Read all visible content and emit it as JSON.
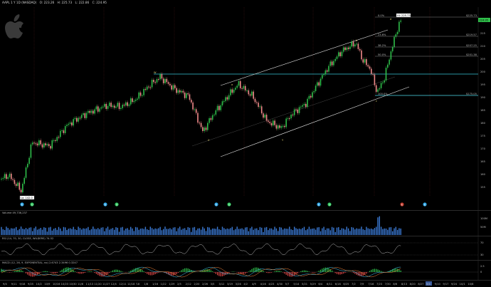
{
  "header": {
    "symbol": "AAPL 1 Y 1D (NASDAQ)",
    "open": "O: 223.26",
    "high": "H: 225.73",
    "low": "L: 222.86",
    "close": "C: 224.95"
  },
  "price_axis": {
    "labels": [
      "220",
      "215",
      "210",
      "205",
      "200",
      "195",
      "190",
      "185",
      "180",
      "175",
      "170",
      "165",
      "160",
      "155"
    ],
    "last_price": "224.95"
  },
  "fib_levels": [
    {
      "label": "0.0%",
      "price": "$225.73"
    },
    {
      "label": "23.6%",
      "price": "$219.57"
    },
    {
      "label": "38.2%",
      "price": "$207.25"
    },
    {
      "label": "50.0%",
      "price": "$201.38"
    },
    {
      "label": "100.0%",
      "price": "$175.05"
    }
  ],
  "annotations": {
    "high_tag": "Hi: 225.73",
    "low_tag": "Lo: 142.0",
    "wave_labels": [
      "W",
      "X",
      "Y",
      "a",
      "b",
      "c",
      "d"
    ]
  },
  "event_markers": [
    {
      "text": "E",
      "color": "#2fa7e8"
    },
    {
      "text": "D",
      "color": "#29c45a"
    },
    {
      "text": "E",
      "color": "#2fa7e8"
    },
    {
      "text": "D",
      "color": "#29c45a"
    },
    {
      "text": "E",
      "color": "#2fa7e8"
    },
    {
      "text": "D",
      "color": "#29c45a"
    },
    {
      "text": "E",
      "color": "#2fa7e8"
    },
    {
      "text": "D",
      "color": "#29c45a"
    },
    {
      "text": "E",
      "color": "#c0392b"
    },
    {
      "text": "E",
      "color": "#2fa7e8"
    }
  ],
  "volume": {
    "title": "Volume  49,736,237",
    "scale": [
      "100M",
      "50M"
    ]
  },
  "rsi": {
    "title": "RSI (14, 70, 30, CLOSE, WILDERS)  74.52",
    "scale": [
      "70",
      "30"
    ]
  },
  "macd": {
    "title": "MACD (12, 26, 9, EXPONENTIAL, no)  2.6743  2.3496  0.3247",
    "scale": [
      "2.5",
      "0"
    ]
  },
  "time_axis": {
    "labels": [
      "9/4",
      "9/11",
      "9/18",
      "9/25",
      "10/2",
      "10/9",
      "10/16",
      "10/23",
      "10/30",
      "11/6",
      "11/13",
      "11/20",
      "11/27",
      "12/4",
      "12/11",
      "12/18",
      "'18",
      "1/8",
      "1/16",
      "1/22",
      "1/29",
      "2/5",
      "2/12",
      "2/20",
      "2/26",
      "3/5",
      "3/12",
      "3/19",
      "3/26",
      "4/2",
      "4/9",
      "4/16",
      "4/23",
      "4/30",
      "5/7",
      "5/14",
      "5/21",
      "5/29",
      "6/4",
      "6/11",
      "6/18",
      "6/25",
      "7/2",
      "7/9",
      "7/16",
      "7/23",
      "7/30",
      "8/6",
      "8/13",
      "8/20",
      "8/27",
      "9/4",
      "9/10",
      "9/17",
      "9/24",
      "10/1",
      "10/8"
    ],
    "current": "9/4"
  },
  "colors": {
    "up": "#2fbf4a",
    "down": "#f08a8a",
    "channel": "#e6e6e6",
    "horizontal": "#37c4d6",
    "fib": "#8a8a8a",
    "volume": "#3b7bd6",
    "rsi": "#bdbdbd",
    "macd_line": "#4bd1ff",
    "macd_signal": "#ff8a3d"
  }
}
